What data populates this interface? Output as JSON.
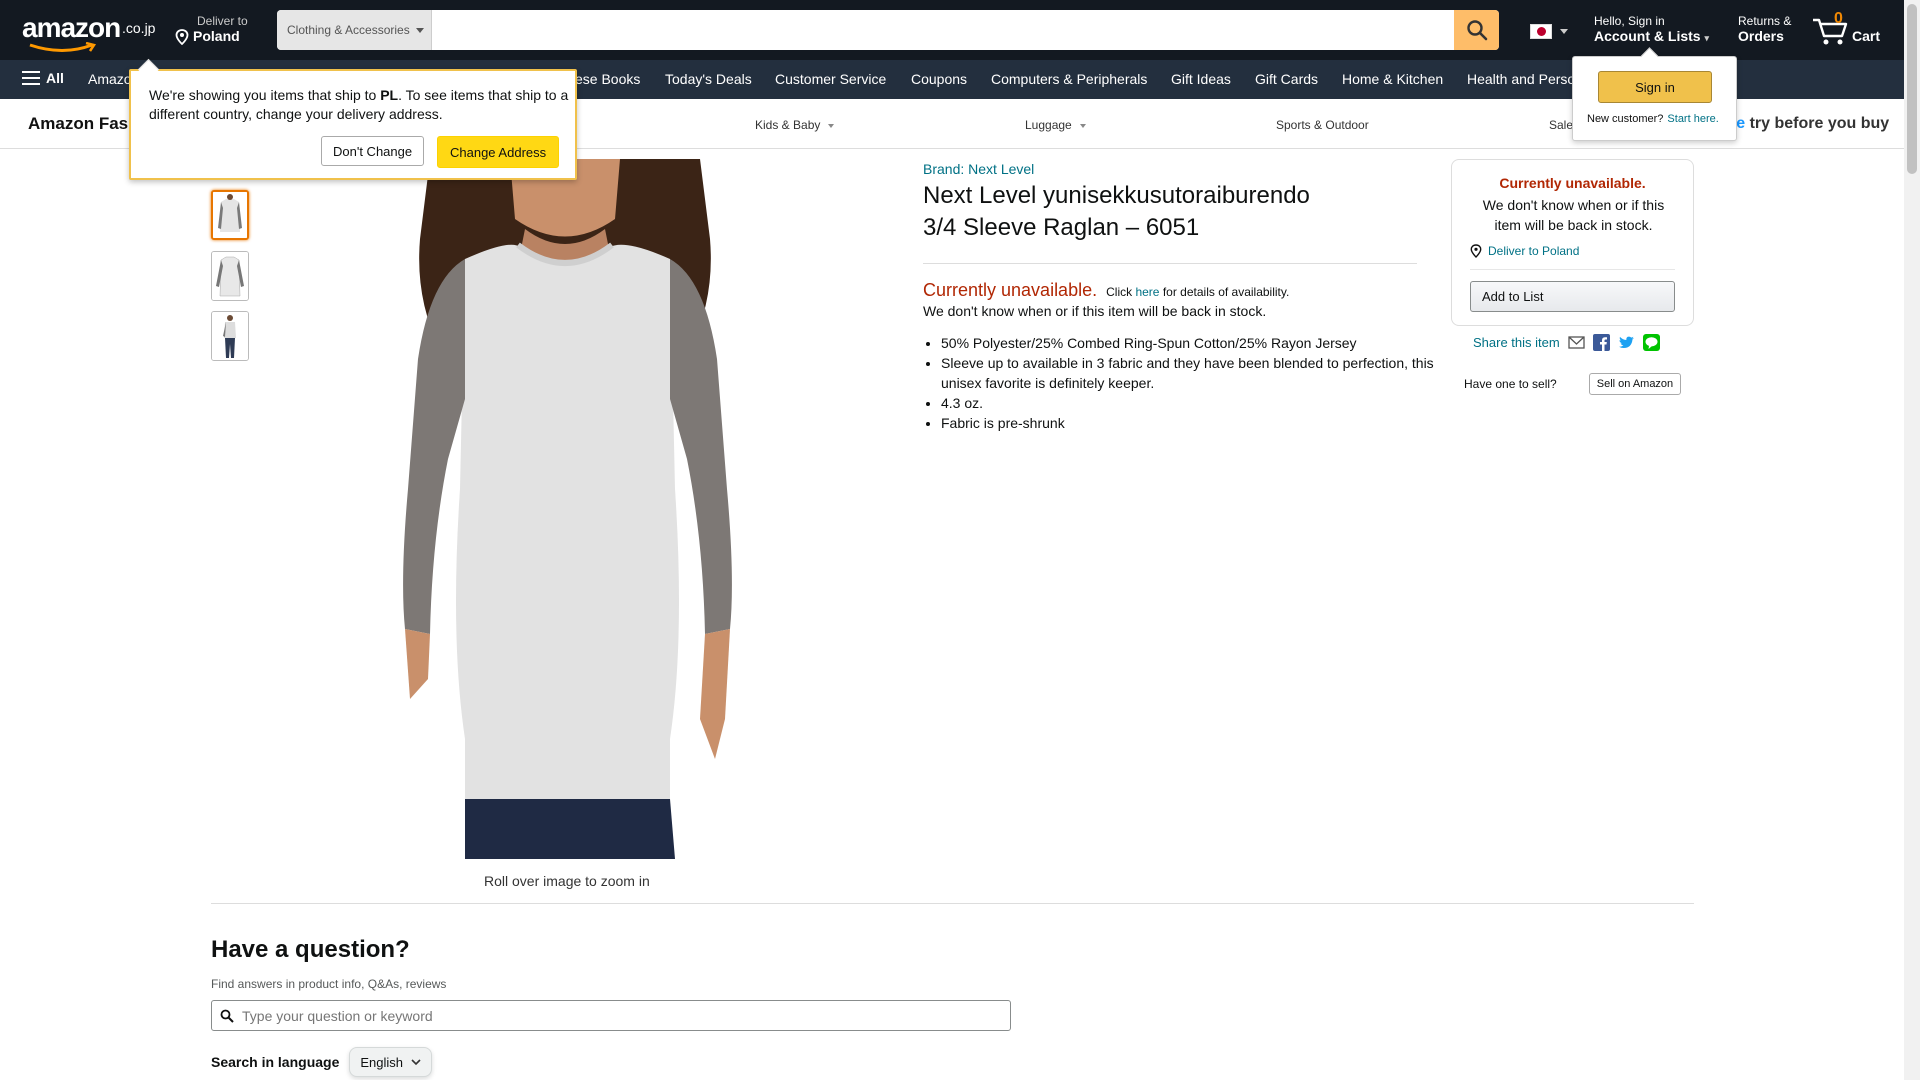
{
  "header": {
    "logo_text": "amazon",
    "logo_tld": ".co.jp",
    "deliver_line1": "Deliver to",
    "deliver_line2": "Poland",
    "search_category": "Clothing & Accessories",
    "search_placeholder": "",
    "account_line1": "Hello, Sign in",
    "account_line2": "Account & Lists",
    "returns_line1": "Returns &",
    "returns_line2": "Orders",
    "cart_count": "0",
    "cart_label": "Cart"
  },
  "nav": {
    "all_label": "All",
    "items": [
      "Amazon",
      "English Books",
      "Today's Deals",
      "Customer Service",
      "Coupons",
      "Computers & Peripherals",
      "Gift Ideas",
      "Gift Cards",
      "Home & Kitchen",
      "Health and Personal Care"
    ],
    "visible_items": [
      "Amazo",
      "ese Books"
    ]
  },
  "subnav": {
    "brand": "Amazon Fashion",
    "brand_visible": "Amazon Fas",
    "items": [
      "Kids & Baby",
      "Luggage",
      "Sports & Outdoor",
      "Sale"
    ],
    "promo_blue": "me",
    "promo_text": " try before you buy"
  },
  "popover": {
    "message_pre": "We're showing you items that ship to ",
    "message_bold": "PL",
    "message_post": ". To see items that ship to a different country, change your delivery address.",
    "dont_change": "Don't Change",
    "change_address": "Change Address"
  },
  "signin_flyout": {
    "button": "Sign in",
    "new_customer": "New customer?",
    "start_here": "Start here."
  },
  "product": {
    "brand": "Brand: Next Level",
    "title": "Next Level yunisekkusutoraiburendo 3/4 Sleeve Raglan – 6051",
    "unavailable": "Currently unavailable.",
    "click_pre": "Click",
    "click_link": "here",
    "click_post": "for details of availability.",
    "back_in_stock": "We don't know when or if this item will be back in stock.",
    "bullets": [
      "50% Polyester/25% Combed Ring-Spun Cotton/25% Rayon Jersey",
      "Sleeve up to available in 3 fabric and they have been blended to perfection, this unisex favorite is definitely keeper.",
      "4.3 oz.",
      "Fabric is pre-shrunk"
    ],
    "zoom_hint": "Roll over image to zoom in"
  },
  "buybox": {
    "unavailable": "Currently unavailable.",
    "message": "We don't know when or if this item will be back in stock.",
    "deliver_to": "Deliver to Poland",
    "add_to_list": "Add to List",
    "share_label": "Share this item",
    "have_one": "Have one to sell?",
    "sell_button": "Sell on Amazon"
  },
  "question": {
    "heading": "Have a question?",
    "subheading": "Find answers in product info, Q&As, reviews",
    "placeholder": "Type your question or keyword",
    "language_label": "Search in language",
    "language_value": "English"
  },
  "colors": {
    "nav_dark": "#131921",
    "nav_secondary": "#232f3e",
    "search_button": "#febd69",
    "sign_in_button": "#f0c14b",
    "change_address_button": "#ffd814",
    "unavailable_red": "#b12704",
    "link_teal": "#007185"
  },
  "icons": [
    "location-pin-icon",
    "search-icon",
    "japan-flag-icon",
    "cart-icon",
    "hamburger-icon",
    "email-icon",
    "facebook-icon",
    "twitter-icon",
    "line-icon",
    "chevron-down-icon"
  ]
}
